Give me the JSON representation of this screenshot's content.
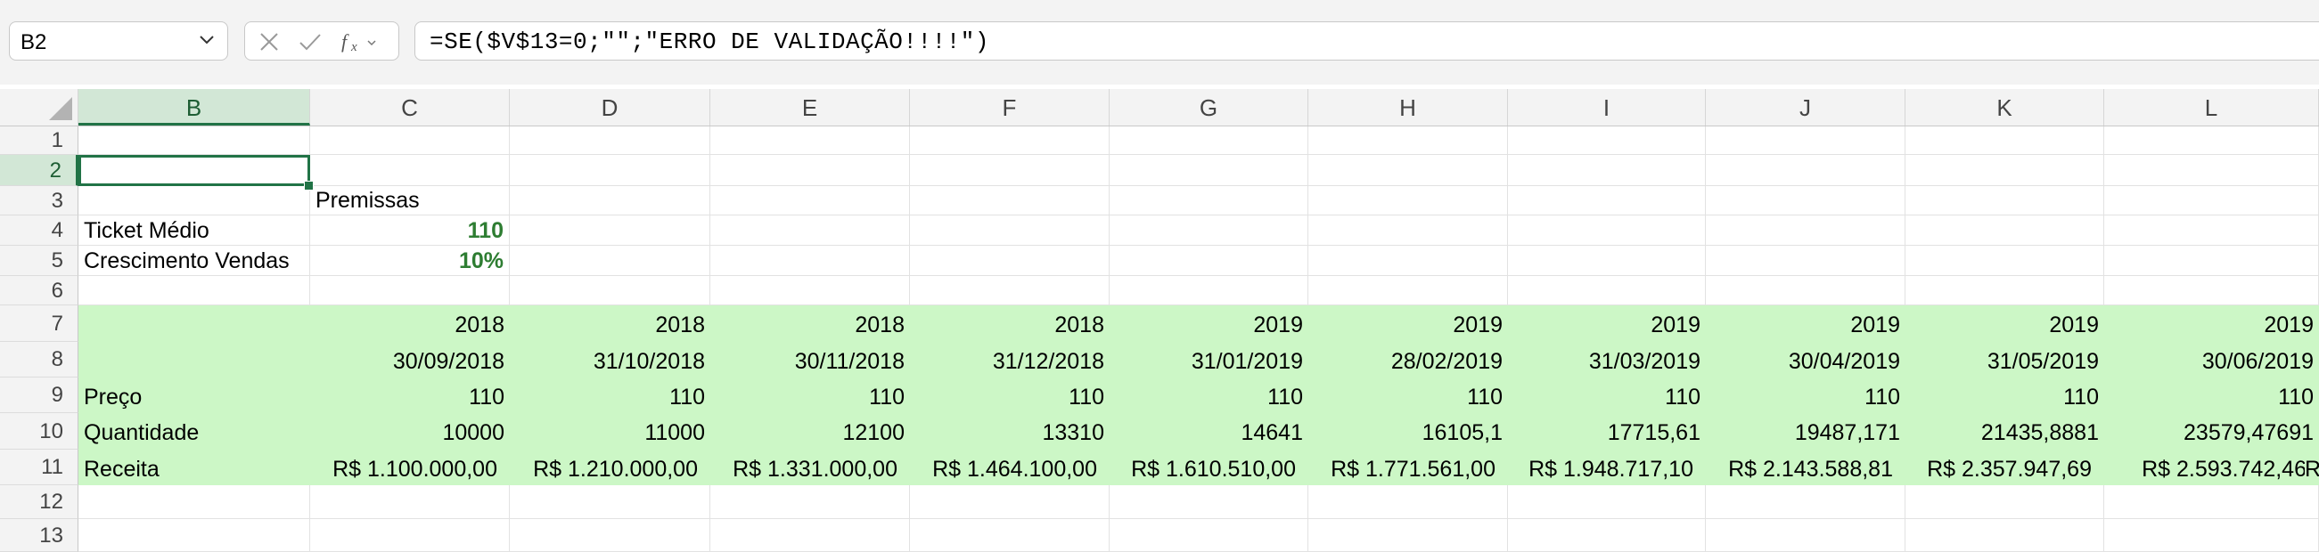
{
  "name_box": {
    "value": "B2"
  },
  "formula_bar": {
    "formula": "=SE($V$13=0;\"\";\"ERRO DE VALIDAÇÃO!!!!\")",
    "fx_label": "fx"
  },
  "columns": [
    "B",
    "C",
    "D",
    "E",
    "F",
    "G",
    "H",
    "I",
    "J",
    "K",
    "L"
  ],
  "rows": [
    "1",
    "2",
    "3",
    "4",
    "5",
    "6",
    "7",
    "8",
    "9",
    "10",
    "11",
    "12",
    "13"
  ],
  "selected": {
    "column": "B",
    "row": "2"
  },
  "sheet": {
    "premissas_label": "Premissas",
    "ticket_medio": {
      "label": "Ticket Médio",
      "value": "110"
    },
    "crescimento_vendas": {
      "label": "Crescimento Vendas",
      "value": "10%"
    },
    "table": {
      "years": [
        "2018",
        "2018",
        "2018",
        "2018",
        "2019",
        "2019",
        "2019",
        "2019",
        "2019",
        "2019"
      ],
      "dates": [
        "30/09/2018",
        "31/10/2018",
        "30/11/2018",
        "31/12/2018",
        "31/01/2019",
        "28/02/2019",
        "31/03/2019",
        "30/04/2019",
        "31/05/2019",
        "30/06/2019"
      ],
      "preco": {
        "label": "Preço",
        "values": [
          "110",
          "110",
          "110",
          "110",
          "110",
          "110",
          "110",
          "110",
          "110",
          "110"
        ]
      },
      "quantidade": {
        "label": "Quantidade",
        "values": [
          "10000",
          "11000",
          "12100",
          "13310",
          "14641",
          "16105,1",
          "17715,61",
          "19487,171",
          "21435,8881",
          "23579,47691"
        ]
      },
      "receita": {
        "label": "Receita",
        "values": [
          "R$ 1.100.000,00",
          "R$ 1.210.000,00",
          "R$ 1.331.000,00",
          "R$ 1.464.100,00",
          "R$ 1.610.510,00",
          "R$ 1.771.561,00",
          "R$ 1.948.717,10",
          "R$ 2.143.588,81",
          "R$ 2.357.947,69",
          "R$ 2.593.742,46"
        ],
        "overflow": "R"
      }
    }
  },
  "colors": {
    "accent": "#217346",
    "table_fill": "#ccf7c6",
    "positive_value": "#2e7d32"
  }
}
